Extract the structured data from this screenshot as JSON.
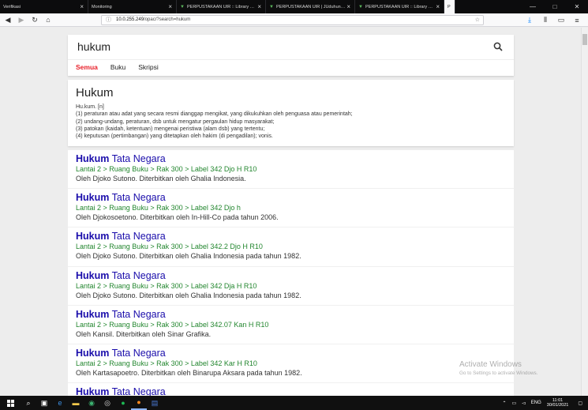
{
  "browser": {
    "tabs": [
      {
        "title": "Verifikasi",
        "active": false
      },
      {
        "title": "Monitoring",
        "active": false
      },
      {
        "title": "PERPUSTAKAAN UIR :: Library …",
        "active": false
      },
      {
        "title": "PERPUSTAKAAN UIR | JUduhun…",
        "active": false
      },
      {
        "title": "PERPUSTAKAAN UIR :: Library …",
        "active": false
      },
      {
        "title": "P",
        "active": true
      }
    ],
    "url_host": "10.0.255.249",
    "url_path": "/opac/?search=hukum"
  },
  "search": {
    "query": "hukum",
    "tabs": [
      {
        "label": "Semua",
        "active": true
      },
      {
        "label": "Buku",
        "active": false
      },
      {
        "label": "Skripsi",
        "active": false
      }
    ]
  },
  "definition": {
    "title": "Hukum",
    "lines": [
      "Hu.kum. [n]",
      "(1) peraturan atau adat yang secara resmi dianggap mengikat, yang dikukuhkan oleh penguasa atau pemerintah;",
      "(2) undang-undang, peraturan, dsb untuk mengatur pergaulan hidup masyarakat;",
      "(3) patokan (kaidah, ketentuan) mengenai peristiwa (alam dsb) yang tertentu;",
      "(4) keputusan (pertimbangan) yang ditetapkan oleh hakim (di pengadilan); vonis."
    ]
  },
  "results": [
    {
      "bold": "Hukum",
      "rest": "Tata Negara",
      "location": "Lantai 2 > Ruang Buku > Rak 300 > Label 342 Djo H R10",
      "desc": "Oleh Djoko Sutono. Diterbitkan oleh Ghalia Indonesia."
    },
    {
      "bold": "Hukum",
      "rest": "Tata Negara",
      "location": "Lantai 2 > Ruang Buku > Rak 300 > Label 342 Djo h",
      "desc": "Oleh Djokosoetono. Diterbitkan oleh In-Hill-Co pada tahun 2006."
    },
    {
      "bold": "Hukum",
      "rest": "Tata Negara",
      "location": "Lantai 2 > Ruang Buku > Rak 300 > Label 342.2 Djo H R10",
      "desc": "Oleh Djoko Sutono. Diterbitkan oleh Ghalia Indonesia pada tahun 1982."
    },
    {
      "bold": "Hukum",
      "rest": "Tata Negara",
      "location": "Lantai 2 > Ruang Buku > Rak 300 > Label 342 Dja H R10",
      "desc": "Oleh Djoko Sutono. Diterbitkan oleh Ghalia Indonesia pada tahun 1982."
    },
    {
      "bold": "Hukum",
      "rest": "Tata Negara",
      "location": "Lantai 2 > Ruang Buku > Rak 300 > Label 342.07 Kan H R10",
      "desc": "Oleh Kansil. Diterbitkan oleh Sinar Grafika."
    },
    {
      "bold": "Hukum",
      "rest": "Tata Negara",
      "location": "Lantai 2 > Ruang Buku > Rak 300 > Label 342 Kar H R10",
      "desc": "Oleh Kartasapoetro. Diterbitkan oleh Binarupa Aksara pada tahun 1982."
    },
    {
      "bold": "Hukum",
      "rest": "Tata Negara",
      "location": "",
      "desc": ""
    }
  ],
  "watermark": {
    "line1": "Activate Windows",
    "line2": "Go to Settings to activate Windows."
  },
  "taskbar": {
    "lang": "ENG",
    "time": "11:01",
    "date": "30/01/2021"
  },
  "colors": {
    "link": "#1a0dab",
    "location": "#22862e",
    "active_tab": "#e8202a"
  }
}
